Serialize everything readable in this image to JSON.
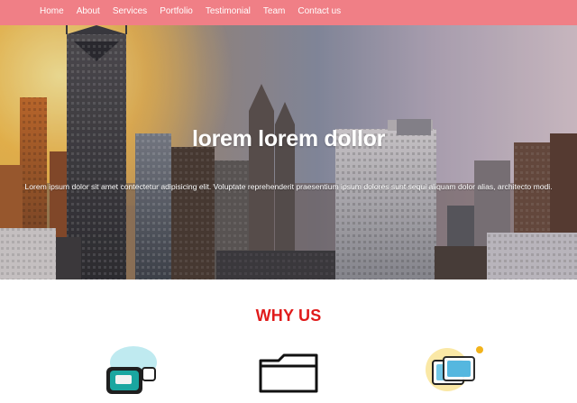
{
  "nav": {
    "items": [
      {
        "label": "Home"
      },
      {
        "label": "About"
      },
      {
        "label": "Services"
      },
      {
        "label": "Portfolio"
      },
      {
        "label": "Testimonial"
      },
      {
        "label": "Team"
      },
      {
        "label": "Contact us"
      }
    ],
    "bar_color": "#f07f86"
  },
  "hero": {
    "title": "lorem lorem dollor",
    "subtitle": "Lorem ipsum dolor sit amet contectetur adipisicing elit. Voluptate reprehenderit praesentium ipsum dolores sunt sequi aliquam dolor alias, architecto modi."
  },
  "why_us": {
    "heading": "WHY US",
    "heading_color": "#e01b1b",
    "icons": [
      {
        "name": "screen-chat-icon"
      },
      {
        "name": "folder-icon"
      },
      {
        "name": "photo-gallery-icon"
      }
    ]
  }
}
